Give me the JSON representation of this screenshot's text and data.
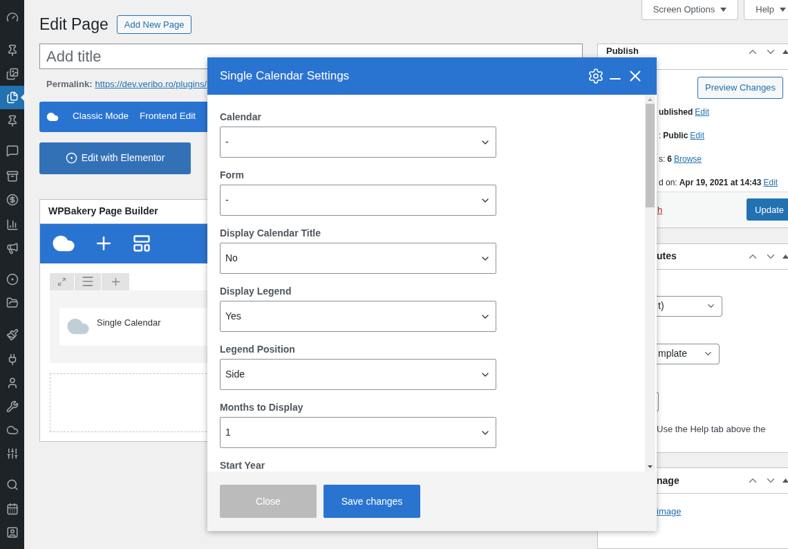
{
  "admin_menu": {
    "items": [
      {
        "selected": false
      },
      {
        "selected": false
      },
      {
        "selected": false
      },
      {
        "selected": true
      },
      {
        "selected": false
      },
      {
        "selected": false
      },
      {
        "selected": false
      },
      {
        "selected": false
      },
      {
        "selected": false
      },
      {
        "selected": false
      },
      {
        "selected": false
      },
      {
        "selected": false
      },
      {
        "selected": false
      },
      {
        "selected": false
      },
      {
        "selected": false
      },
      {
        "selected": false
      },
      {
        "selected": false
      },
      {
        "selected": false
      },
      {
        "selected": false
      },
      {
        "selected": false
      },
      {
        "selected": false
      }
    ]
  },
  "top_buttons": [
    {
      "label": "Screen Options"
    },
    {
      "label": "Help"
    }
  ],
  "page": {
    "title": "Edit Page",
    "add_new_button": "Add New Page",
    "title_field": {
      "placeholder": "Add title"
    },
    "permalink": {
      "label": "Permalink:",
      "url": "https://dev.veribo.ro/plugins/"
    },
    "mode_bar": {
      "buttons": [
        "Classic Mode",
        "Frontend Edit"
      ]
    },
    "elementor_button": "Edit with Elementor",
    "builder": {
      "title": "WPBakery Page Builder",
      "elements": [
        {
          "name": "Single Calendar"
        }
      ]
    }
  },
  "sidebar": {
    "publish": {
      "title": "Publish",
      "preview_button": "Preview Changes",
      "rows": [
        {
          "prefix": "",
          "value": "ublished",
          "link": "Edit"
        },
        {
          "prefix": ":",
          "value": "Public",
          "link": "Edit"
        },
        {
          "prefix": "s:",
          "value": "6",
          "link": "Browse"
        },
        {
          "prefix": "d on:",
          "value": "Apr 19, 2021 at 14:43",
          "link": "Edit"
        }
      ],
      "trash_link": "h",
      "update_button": "Update"
    },
    "attributes": {
      "title": "utes",
      "selects": [
        {
          "value": "t)"
        },
        {
          "value": "mplate"
        }
      ],
      "help_text": "Use the Help tab above the"
    },
    "featured_image": {
      "title": "nage",
      "link": "image"
    }
  },
  "modal": {
    "title": "Single Calendar Settings",
    "fields": [
      {
        "label": "Calendar",
        "value": "-"
      },
      {
        "label": "Form",
        "value": "-"
      },
      {
        "label": "Display Calendar Title",
        "value": "No"
      },
      {
        "label": "Display Legend",
        "value": "Yes"
      },
      {
        "label": "Legend Position",
        "value": "Side"
      },
      {
        "label": "Months to Display",
        "value": "1"
      },
      {
        "label": "Start Year"
      }
    ],
    "buttons": [
      {
        "label": "Close",
        "kind": "secondary"
      },
      {
        "label": "Save changes",
        "kind": "primary"
      }
    ]
  }
}
